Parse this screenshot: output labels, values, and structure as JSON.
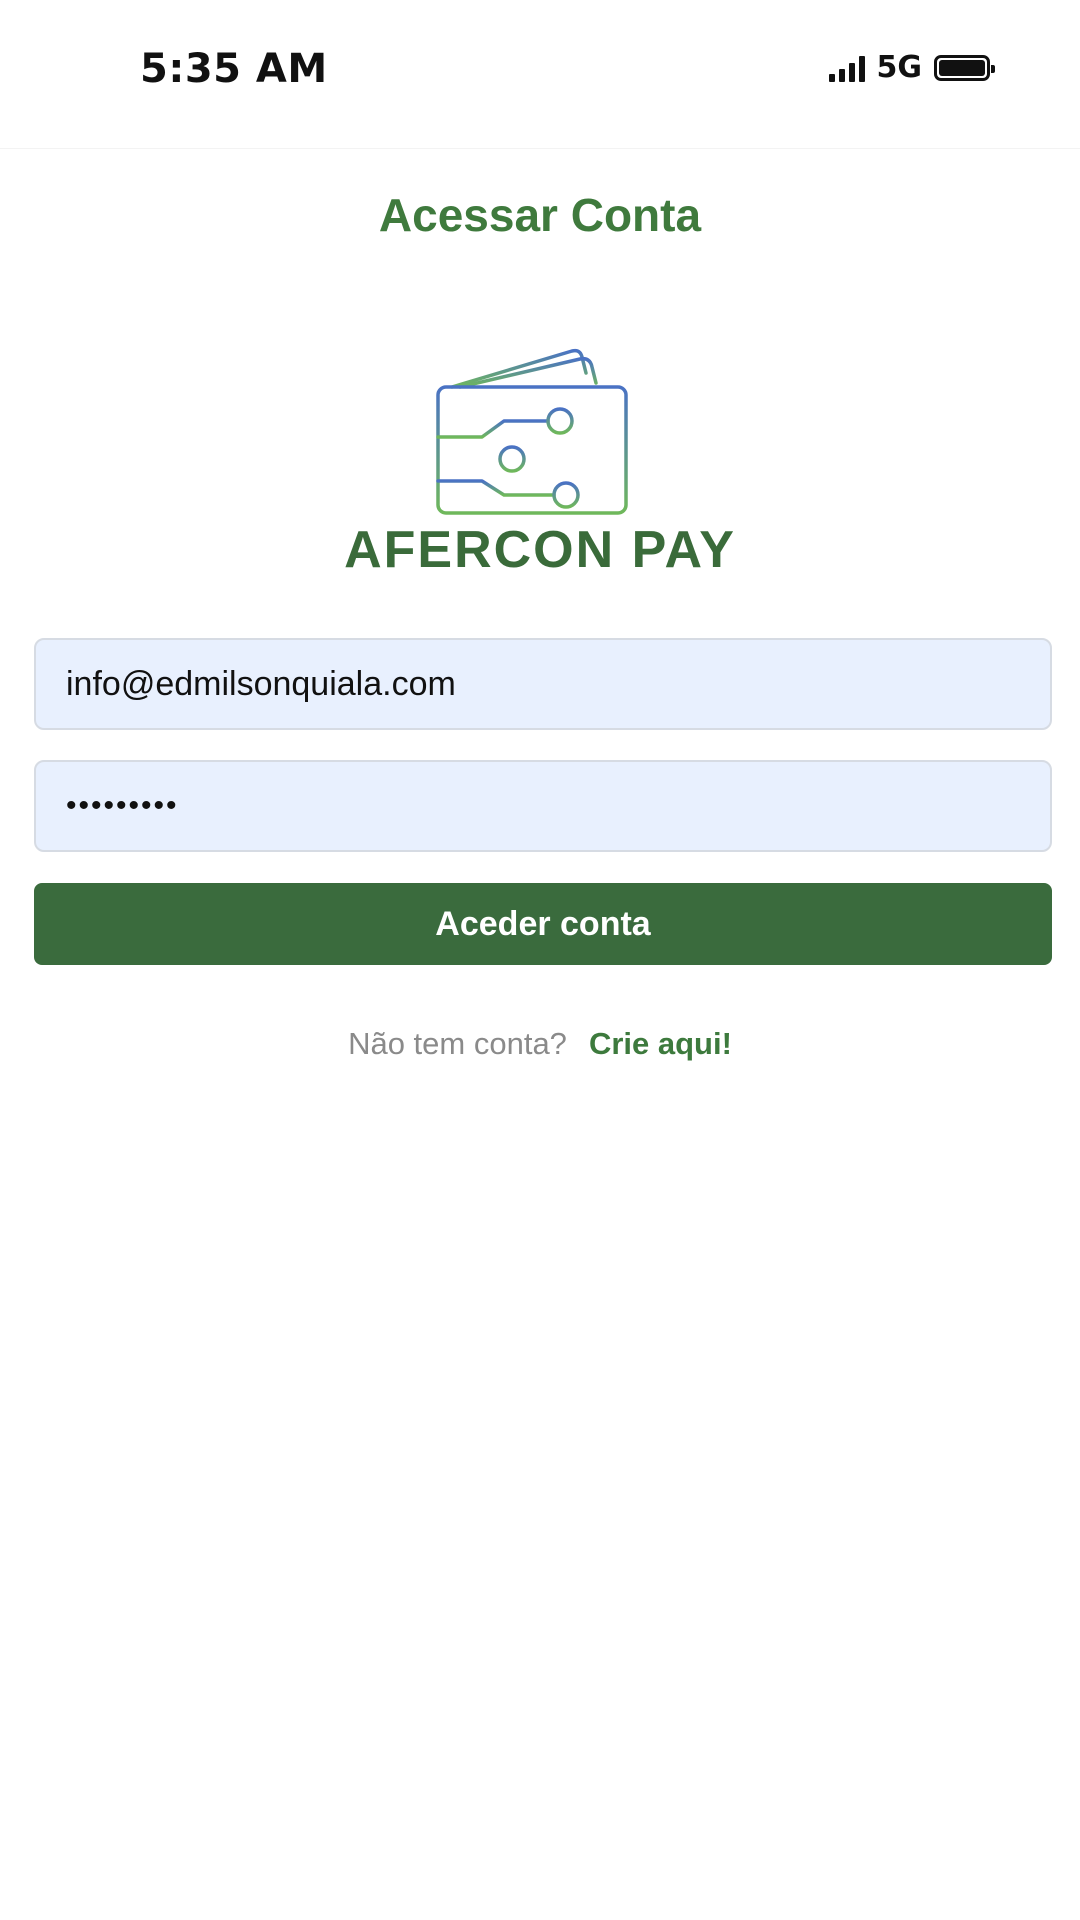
{
  "status_bar": {
    "time": "5:35 AM",
    "network": "5G",
    "icons": [
      "signal-icon",
      "battery-icon"
    ]
  },
  "page": {
    "title": "Acessar Conta"
  },
  "brand": {
    "name": "AFERCON PAY",
    "logo_icon": "wallet-circuit-logo",
    "logo_colors": [
      "#4a72c4",
      "#6fb85b"
    ],
    "title_color": "#3f7a3d"
  },
  "form": {
    "email_value": "info@edmilsonquiala.com",
    "password_value": "•••••••••",
    "submit_label": "Aceder conta",
    "input_background": "#e8f0fe",
    "button_color": "#3a6b3d"
  },
  "register": {
    "prompt": "Não tem conta?",
    "link_label": "Crie aqui!"
  }
}
